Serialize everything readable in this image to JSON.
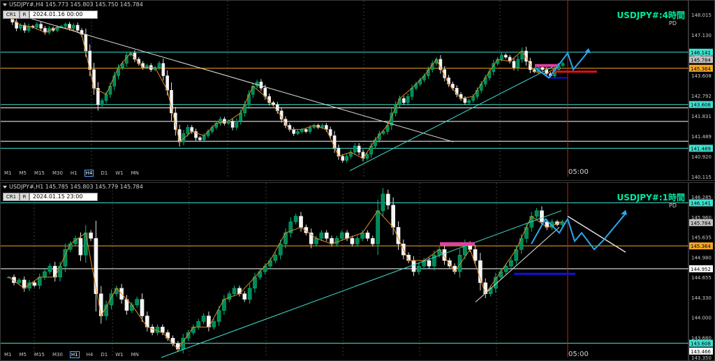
{
  "panels": [
    {
      "header": "USDJPY#,H4  145.773 145.803 145.750 145.784",
      "btn_cr": "CR1",
      "btn_r": "R",
      "date_box": "2024.01.16 00:00",
      "title": "USDJPY#:4時間",
      "pd": "PD",
      "timeframes": [
        "M1",
        "M5",
        "M15",
        "M30",
        "H1",
        "H4",
        "D1",
        "W1",
        "MN"
      ],
      "selected_tf": "H4",
      "time_label": "05:00",
      "price_axis": {
        "ticks": [
          "148.015",
          "147.130",
          "144.957",
          "143.608",
          "142.792",
          "141.831",
          "141.489",
          "140.920",
          "140.115"
        ],
        "tags": [
          {
            "label": "146.141",
            "value": 146.141,
            "bg": "#40e0d0",
            "fg": "#000"
          },
          {
            "label": "145.784",
            "value": 145.784,
            "bg": "#c0c0c0",
            "fg": "#000"
          },
          {
            "label": "145.364",
            "value": 145.364,
            "bg": "#f5a623",
            "fg": "#000"
          },
          {
            "label": "143.608",
            "value": 143.608,
            "bg": "#40e0d0",
            "fg": "#000"
          },
          {
            "label": "141.489",
            "value": 141.489,
            "bg": "#40e0d0",
            "fg": "#000"
          }
        ]
      }
    },
    {
      "header": "USDJPY#,H1  145.785 145.803 145.779 145.784",
      "btn_cr": "CR1",
      "btn_r": "R",
      "date_box": "2024.01.15 23:00",
      "title": "USDJPY#:1時間",
      "pd": "PD",
      "timeframes": [
        "M1",
        "M5",
        "M15",
        "M30",
        "H1",
        "H4",
        "D1",
        "W1",
        "MN"
      ],
      "selected_tf": "H1",
      "time_label": "05:00",
      "price_axis": {
        "ticks": [
          "146.285",
          "145.960",
          "145.635",
          "144.980",
          "144.655",
          "144.330",
          "144.000",
          "143.680",
          "143.350"
        ],
        "tags": [
          {
            "label": "146.141",
            "value": 146.141,
            "bg": "#40e0d0",
            "fg": "#000"
          },
          {
            "label": "145.784",
            "value": 145.784,
            "bg": "#c0c0c0",
            "fg": "#000"
          },
          {
            "label": "145.364",
            "value": 145.364,
            "bg": "#f5a623",
            "fg": "#000"
          },
          {
            "label": "144.952",
            "value": 144.952,
            "bg": "#ffffff",
            "fg": "#000"
          },
          {
            "label": "143.608",
            "value": 143.608,
            "bg": "#40e0d0",
            "fg": "#000"
          },
          {
            "label": "143.466",
            "value": 143.466,
            "bg": "#ffffff",
            "fg": "#000"
          }
        ]
      }
    }
  ],
  "chart_data": [
    {
      "type": "candlestick",
      "symbol": "USDJPY#",
      "timeframe": "H4",
      "ylim": [
        140.115,
        148.5
      ],
      "horizontal_levels": [
        {
          "value": 146.141,
          "color": "#40e0d0"
        },
        {
          "value": 145.364,
          "color": "#f5a623"
        },
        {
          "value": 143.608,
          "color": "#40e0d0"
        },
        {
          "value": 143.45,
          "color": "#ffffff"
        },
        {
          "value": 142.792,
          "color": "#ffffff"
        },
        {
          "value": 141.831,
          "color": "#ffffff"
        },
        {
          "value": 141.489,
          "color": "#40e0d0"
        }
      ],
      "closes": [
        147.9,
        147.6,
        147.3,
        147.45,
        147.2,
        147.4,
        147.35,
        147.5,
        147.3,
        147.1,
        147.3,
        147.2,
        147.35,
        147.4,
        147.5,
        147.3,
        147.45,
        147.2,
        147.0,
        146.2,
        145.3,
        144.4,
        143.6,
        143.8,
        144.1,
        144.5,
        145.0,
        145.4,
        145.6,
        146.0,
        146.1,
        145.8,
        145.6,
        145.4,
        145.5,
        145.3,
        145.4,
        145.6,
        145.0,
        144.3,
        143.2,
        142.4,
        141.8,
        142.2,
        142.5,
        142.3,
        142.0,
        141.9,
        142.1,
        142.3,
        142.5,
        142.7,
        142.9,
        142.7,
        142.8,
        142.5,
        142.8,
        143.2,
        143.6,
        144.1,
        144.5,
        144.7,
        144.4,
        144.0,
        143.7,
        143.6,
        143.3,
        142.9,
        142.6,
        142.4,
        142.2,
        142.3,
        142.4,
        142.3,
        142.5,
        142.6,
        142.5,
        142.6,
        142.4,
        142.1,
        141.5,
        141.1,
        140.9,
        141.1,
        141.3,
        141.6,
        141.3,
        141.0,
        141.2,
        141.6,
        141.9,
        142.2,
        142.3,
        142.6,
        143.2,
        143.6,
        143.9,
        143.7,
        144.0,
        144.4,
        144.6,
        144.8,
        145.0,
        145.3,
        145.6,
        145.8,
        145.3,
        144.9,
        144.6,
        144.4,
        144.1,
        143.9,
        143.7,
        143.8,
        144.0,
        144.3,
        144.6,
        144.9,
        145.2,
        145.6,
        145.8,
        146.0,
        145.9,
        145.7,
        145.4,
        145.8,
        146.2,
        145.7,
        145.3,
        145.2,
        145.4,
        145.3,
        145.1,
        145.0,
        145.3,
        145.5,
        145.6
      ]
    },
    {
      "type": "candlestick",
      "symbol": "USDJPY#",
      "timeframe": "H1",
      "ylim": [
        143.35,
        146.45
      ],
      "horizontal_levels": [
        {
          "value": 146.141,
          "color": "#40e0d0"
        },
        {
          "value": 145.364,
          "color": "#f5a623"
        },
        {
          "value": 144.952,
          "color": "#ffffff"
        },
        {
          "value": 143.608,
          "color": "#40e0d0"
        }
      ],
      "closes": [
        144.8,
        144.7,
        144.75,
        144.6,
        144.7,
        144.65,
        144.8,
        144.9,
        145.0,
        144.8,
        145.0,
        145.3,
        145.4,
        145.5,
        145.2,
        145.6,
        145.5,
        144.5,
        144.1,
        144.3,
        144.5,
        144.6,
        144.4,
        144.2,
        144.3,
        144.4,
        144.1,
        143.9,
        143.8,
        143.9,
        143.8,
        143.7,
        143.6,
        143.5,
        143.7,
        143.8,
        143.9,
        144.0,
        144.1,
        143.9,
        144.0,
        144.2,
        144.4,
        144.5,
        144.6,
        144.5,
        144.4,
        144.6,
        144.8,
        144.9,
        145.0,
        145.1,
        145.2,
        145.4,
        145.6,
        145.8,
        145.9,
        145.7,
        145.6,
        145.4,
        145.5,
        145.6,
        145.5,
        145.4,
        145.5,
        145.6,
        145.5,
        145.4,
        145.5,
        145.6,
        145.5,
        145.4,
        146.0,
        146.3,
        146.1,
        145.7,
        145.4,
        145.2,
        145.1,
        144.9,
        145.0,
        145.1,
        145.0,
        145.2,
        145.3,
        145.1,
        145.0,
        144.9,
        145.2,
        145.4,
        145.3,
        145.1,
        144.7,
        144.5,
        144.6,
        144.8,
        144.9,
        145.0,
        145.1,
        145.3,
        145.5,
        145.7,
        145.9,
        146.0,
        145.8,
        145.7,
        145.8,
        145.75,
        145.8
      ]
    }
  ]
}
